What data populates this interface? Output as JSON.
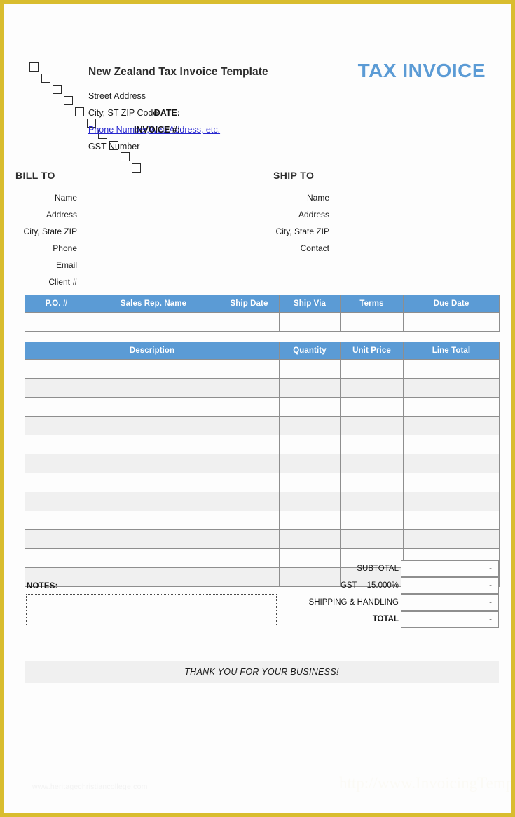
{
  "document": {
    "accent_color": "#5b9bd5",
    "page_border_color": "#d9bd2f",
    "stripe_color": "#f0f0f0"
  },
  "header": {
    "company_title": "New Zealand Tax Invoice Template",
    "street_address": "Street Address",
    "city_state_zip": "City, ST  ZIP Code",
    "contact_link": "Phone Number,Web Address, etc.",
    "gst_number": "GST Number",
    "doc_title": "TAX INVOICE",
    "date_label": "DATE:",
    "invoice_no_label": "INVOICE #:"
  },
  "bill_to": {
    "heading": "BILL TO",
    "fields": [
      "Name",
      "Address",
      "City, State ZIP",
      "Phone",
      "Email",
      "Client #"
    ]
  },
  "ship_to": {
    "heading": "SHIP TO",
    "fields": [
      "Name",
      "Address",
      "City, State ZIP",
      "Contact"
    ]
  },
  "info_table": {
    "columns": [
      "P.O. #",
      "Sales Rep. Name",
      "Ship Date",
      "Ship Via",
      "Terms",
      "Due Date"
    ],
    "row": [
      "",
      "",
      "",
      "",
      "",
      ""
    ]
  },
  "items_table": {
    "columns": [
      "Description",
      "Quantity",
      "Unit Price",
      "Line Total"
    ],
    "rows": [
      [
        "",
        "",
        "",
        ""
      ],
      [
        "",
        "",
        "",
        ""
      ],
      [
        "",
        "",
        "",
        ""
      ],
      [
        "",
        "",
        "",
        ""
      ],
      [
        "",
        "",
        "",
        ""
      ],
      [
        "",
        "",
        "",
        ""
      ],
      [
        "",
        "",
        "",
        ""
      ],
      [
        "",
        "",
        "",
        ""
      ],
      [
        "",
        "",
        "",
        ""
      ],
      [
        "",
        "",
        "",
        ""
      ],
      [
        "",
        "",
        "",
        ""
      ],
      [
        "",
        "",
        "",
        ""
      ]
    ]
  },
  "notes": {
    "label": "NOTES:",
    "value": "",
    "placeholder": ""
  },
  "totals": {
    "subtotal_label": "SUBTOTAL",
    "subtotal_value": "-",
    "gst_label": "GST",
    "gst_rate": "15.000%",
    "gst_value": "-",
    "shipping_label": "SHIPPING & HANDLING",
    "shipping_value": "-",
    "total_label": "TOTAL",
    "total_value": "-"
  },
  "footer": {
    "thanks": "THANK YOU FOR YOUR BUSINESS!",
    "watermark_left": "www.heritagechristiancollege.com",
    "watermark_right": "http://www.InvoicingTemplate.com"
  }
}
